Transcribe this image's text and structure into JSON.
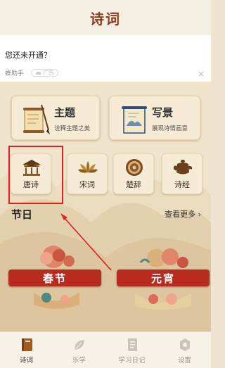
{
  "header": {
    "title": "诗词"
  },
  "ad": {
    "question": "您还未开通？",
    "brand": "蜂助手",
    "badge": "广告",
    "close": "×"
  },
  "cards": [
    {
      "title": "主题",
      "subtitle": "诠释主题之美",
      "icon": "scroll-brush-icon"
    },
    {
      "title": "写景",
      "subtitle": "展现诗情画意",
      "icon": "painting-scroll-icon"
    }
  ],
  "categories": [
    {
      "label": "唐诗",
      "icon": "pavilion-icon"
    },
    {
      "label": "宋词",
      "icon": "lotus-icon"
    },
    {
      "label": "楚辞",
      "icon": "seal-icon"
    },
    {
      "label": "诗经",
      "icon": "teapot-icon"
    }
  ],
  "festivals": {
    "title": "节日",
    "more": "查看更多 ›",
    "items": [
      "春节",
      "元宵"
    ]
  },
  "tabs": [
    {
      "label": "诗词",
      "icon": "book-icon",
      "active": true
    },
    {
      "label": "乐学",
      "icon": "leaf-icon",
      "active": false
    },
    {
      "label": "学习日记",
      "icon": "notebook-icon",
      "active": false
    },
    {
      "label": "设置",
      "icon": "gear-icon",
      "active": false
    }
  ],
  "colors": {
    "accent": "#b72c1e",
    "title": "#8b3b1e",
    "highlight": "#e02020"
  }
}
